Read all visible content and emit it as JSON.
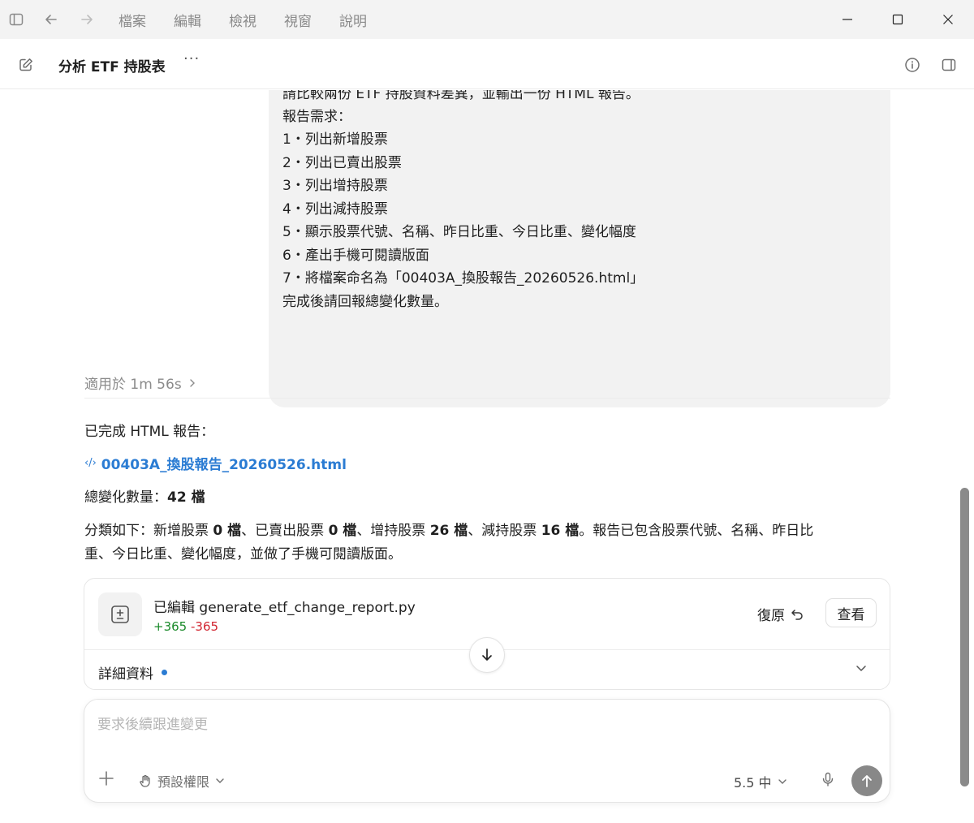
{
  "titlebar": {
    "menu": [
      "檔案",
      "編輯",
      "檢視",
      "視窗",
      "說明"
    ]
  },
  "header": {
    "title": "分析 ETF 持股表",
    "more": "···"
  },
  "user_message": {
    "lines": [
      "請比較兩份 ETF 持股資料差異，並輸出一份 HTML 報告。",
      "報告需求：",
      "1・列出新增股票",
      "2・列出已賣出股票",
      "3・列出增持股票",
      "4・列出減持股票",
      "5・顯示股票代號、名稱、昨日比重、今日比重、變化幅度",
      "6・產出手機可閱讀版面",
      "7・將檔案命名為「00403A_換股報告_20260526.html」",
      "完成後請回報總變化數量。"
    ]
  },
  "response": {
    "worked_label": "適用於 1m 56s",
    "done_text": "已完成 HTML 報告：",
    "file_name": "00403A_換股報告_20260526.html",
    "total_label": "總變化數量：",
    "total_value": "42 檔",
    "summary": {
      "p1": "分類如下：新增股票 ",
      "v1": "0 檔",
      "p2": "、已賣出股票 ",
      "v2": "0 檔",
      "p3": "、增持股票 ",
      "v3": "26 檔",
      "p4": "、減持股票 ",
      "v4": "16 檔",
      "p5": "。報告已包含股票代號、名稱、昨日比",
      "line2": "重、今日比重、變化幅度，並做了手機可閱讀版面。"
    }
  },
  "edit_card": {
    "title": "已編輯 generate_etf_change_report.py",
    "additions": "+365",
    "deletions": "-365",
    "revert_label": "復原",
    "view_label": "查看",
    "details_label": "詳細資料"
  },
  "composer": {
    "placeholder": "要求後續跟進變更",
    "permission_label": "預設權限",
    "model_label": "5.5 中"
  }
}
